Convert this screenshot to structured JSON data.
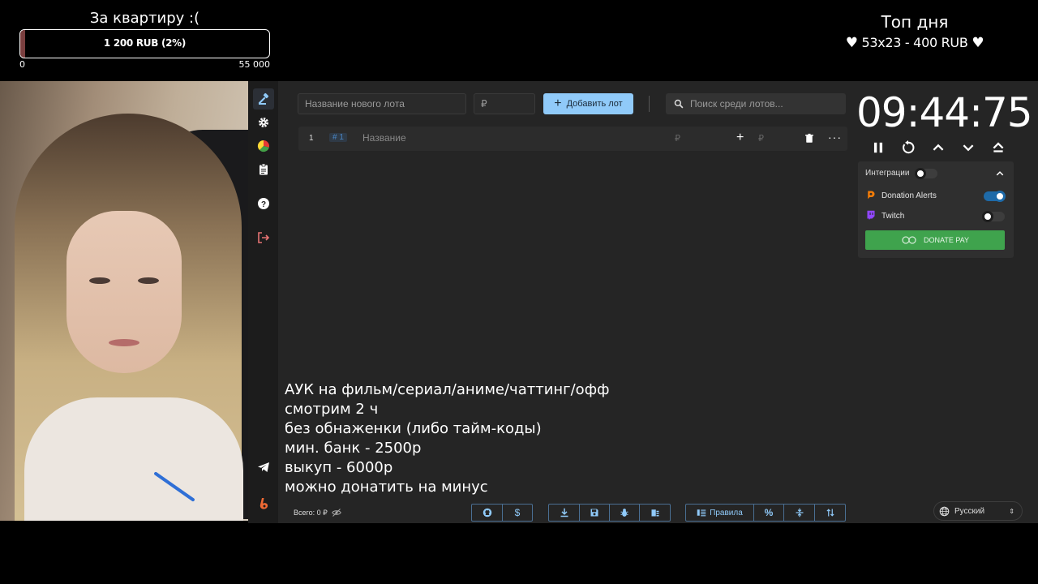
{
  "goal": {
    "title": "За квартиру :(",
    "bar_text": "1 200 RUB (2%)",
    "progress_percent": 2,
    "min": "0",
    "max": "55 000"
  },
  "top_day": {
    "title": "Топ дня",
    "line": "53x23 - 400 RUB"
  },
  "toolbar": {
    "lot_name_placeholder": "Название нового лота",
    "amount_placeholder": "₽",
    "add_label": "Добавить лот",
    "search_placeholder": "Поиск среди лотов..."
  },
  "lot": {
    "index": "1",
    "id": "# 1",
    "name_placeholder": "Название",
    "amount_symbol": "₽",
    "add_amount_symbol": "₽"
  },
  "timer": {
    "value": "09:44:75"
  },
  "integrations": {
    "title": "Интеграции",
    "master_on": false,
    "items": [
      {
        "label": "Donation Alerts",
        "on": true,
        "icon": "donation-alerts-icon"
      },
      {
        "label": "Twitch",
        "on": false,
        "icon": "twitch-icon"
      }
    ],
    "donate_label": "DONATE PAY"
  },
  "overlay_text": {
    "lines": [
      "АУК на фильм/сериал/аниме/чаттинг/офф",
      "смотрим 2 ч",
      "без обнаженки (либо тайм-коды)",
      "мин. банк - 2500р",
      "выкуп - 6000р",
      "можно донатить на минус"
    ]
  },
  "footer": {
    "total_label": "Всего: 0 ₽",
    "rules_label": "Правила",
    "language": "Русский"
  },
  "colors": {
    "accent": "#90caf9",
    "donate": "#3fa34d",
    "logout": "#e57373",
    "background": "#252525"
  }
}
